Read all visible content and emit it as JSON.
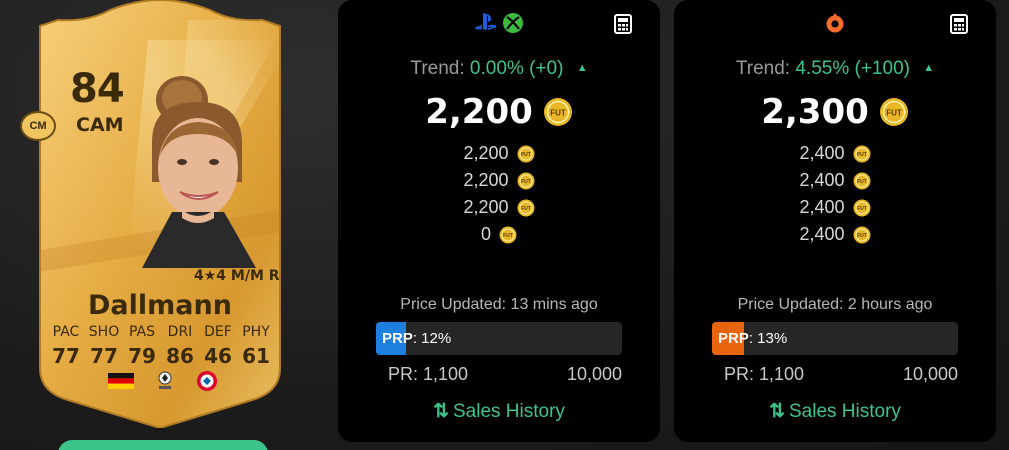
{
  "card": {
    "rating": "84",
    "position": "CAM",
    "alt_position": "CM",
    "skills": "4★4 M/M R",
    "name": "Dallmann",
    "stat_labels": [
      "PAC",
      "SHO",
      "PAS",
      "DRI",
      "DEF",
      "PHY"
    ],
    "stat_values": [
      "77",
      "77",
      "79",
      "86",
      "46",
      "61"
    ],
    "nation_flag": "germany-flag-icon",
    "league_badge": "league-badge-icon",
    "club_badge": "club-badge-icon",
    "card_color": "#e8b84a"
  },
  "panels": [
    {
      "platform_icons": [
        "playstation-icon",
        "xbox-icon"
      ],
      "trend_label": "Trend:",
      "trend_value": "0.00% (+0)",
      "trend_arrow": "▲",
      "price": "2,200",
      "coin_label": "FUT",
      "prices": [
        "2,200",
        "2,200",
        "2,200",
        "0"
      ],
      "updated": "Price Updated: 13 mins ago",
      "prp_label": "PRP",
      "prp_value": ": 12%",
      "prp_percent": 12,
      "prp_color": "#1d7fe0",
      "pr_label_min": "PR: 1,100",
      "pr_label_max": "10,000",
      "sales_history": "Sales History",
      "sales_icon": "⇅"
    },
    {
      "platform_icons": [
        "origin-icon"
      ],
      "trend_label": "Trend:",
      "trend_value": "4.55% (+100)",
      "trend_arrow": "▲",
      "price": "2,300",
      "coin_label": "FUT",
      "prices": [
        "2,400",
        "2,400",
        "2,400",
        "2,400"
      ],
      "updated": "Price Updated: 2 hours ago",
      "prp_label": "PRP",
      "prp_value": ": 13%",
      "prp_percent": 13,
      "prp_color": "#e8650d",
      "pr_label_min": "PR: 1,100",
      "pr_label_max": "10,000",
      "sales_history": "Sales History",
      "sales_icon": "⇅"
    }
  ],
  "colors": {
    "accent_green": "#3cc48a",
    "coin_gold": "#e9b726",
    "panel_bg": "#000000"
  }
}
